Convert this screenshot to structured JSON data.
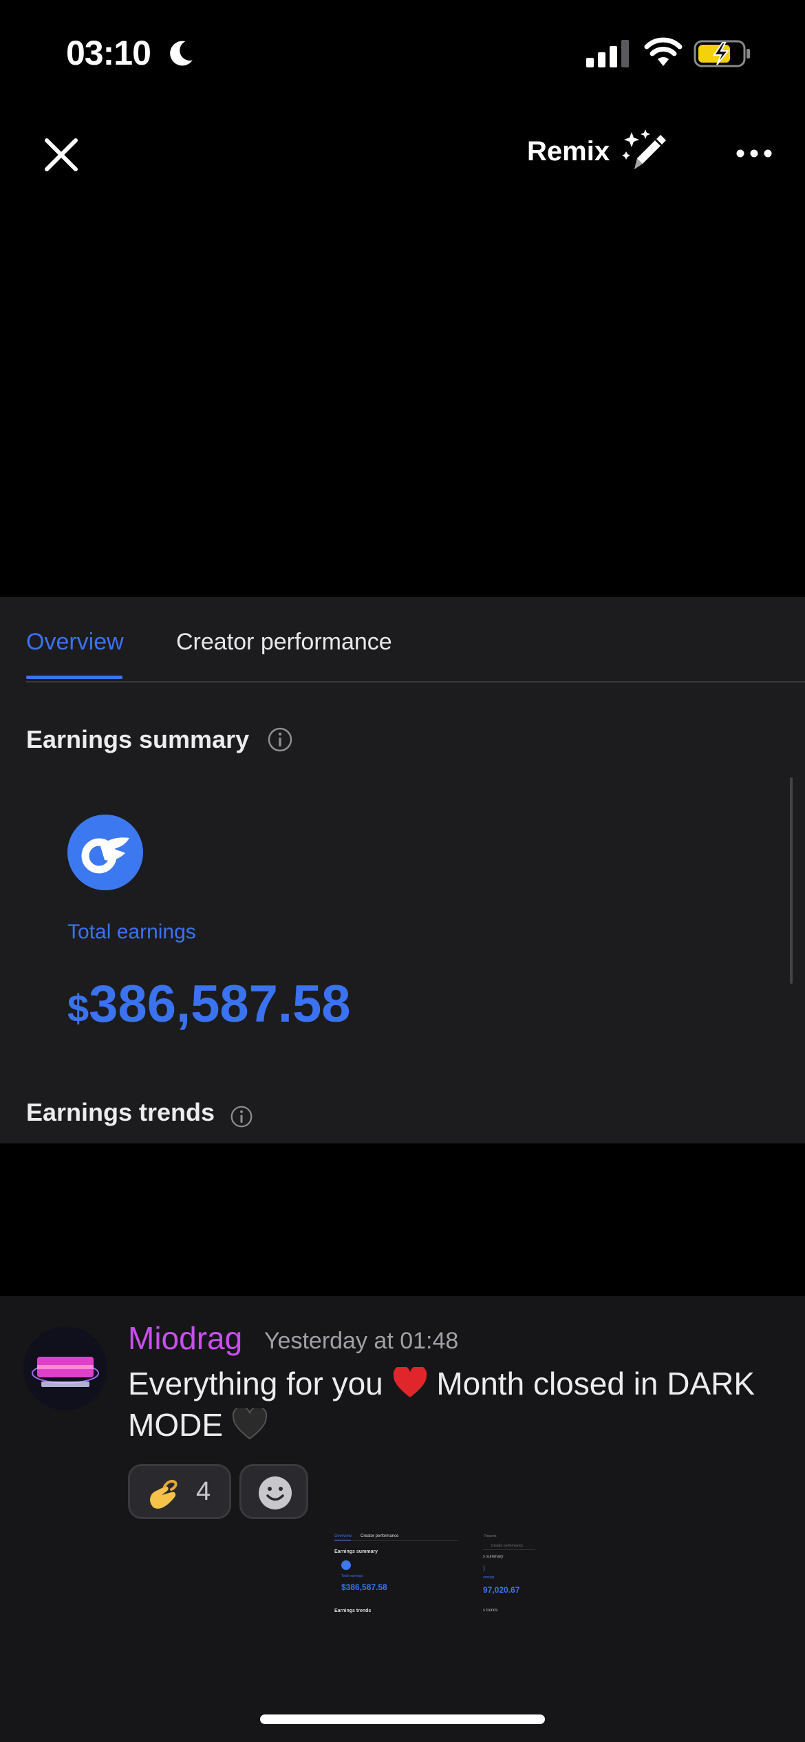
{
  "status_bar": {
    "time": "03:10",
    "icons": [
      "moon-icon",
      "signal-icon",
      "wifi-icon",
      "battery-charging-icon"
    ],
    "battery_color": "#f5d10b"
  },
  "top_bar": {
    "close_icon": "close-icon",
    "remix_label": "Remix",
    "remix_icon": "magic-pencil-icon",
    "more_icon": "more-icon"
  },
  "image_panel": {
    "tabs": [
      {
        "label": "Overview",
        "active": true
      },
      {
        "label": "Creator performance",
        "active": false
      }
    ],
    "earnings_summary_heading": "Earnings summary",
    "total_earnings_label": "Total earnings",
    "total_earnings_currency": "$",
    "total_earnings_value": "386,587.58",
    "earnings_trends_heading": "Earnings trends",
    "accent_color": "#3b72f0"
  },
  "message": {
    "author": "Miodrag",
    "author_color": "#c94ef0",
    "timestamp": "Yesterday at 01:48",
    "text_part1": "Everything for you",
    "text_part2": "Month closed in DARK",
    "text_line2": "MODE",
    "reactions": [
      {
        "emoji": "pinching-hand",
        "count": "4"
      }
    ],
    "add_reaction_icon": "smiley-icon"
  },
  "thumbnail": {
    "tab1": "Overview",
    "tab2": "Creator performance",
    "summary": "Earnings summary",
    "total_label": "Total earnings",
    "amount": "$386,587.58",
    "trends": "Earnings trends",
    "right_header": "Reports",
    "right_tab": "Creator performance",
    "right_summary": "s summary",
    "right_logo": ")",
    "right_label": "arnings",
    "right_amount": "97,020.67",
    "right_trends": "s trends"
  }
}
